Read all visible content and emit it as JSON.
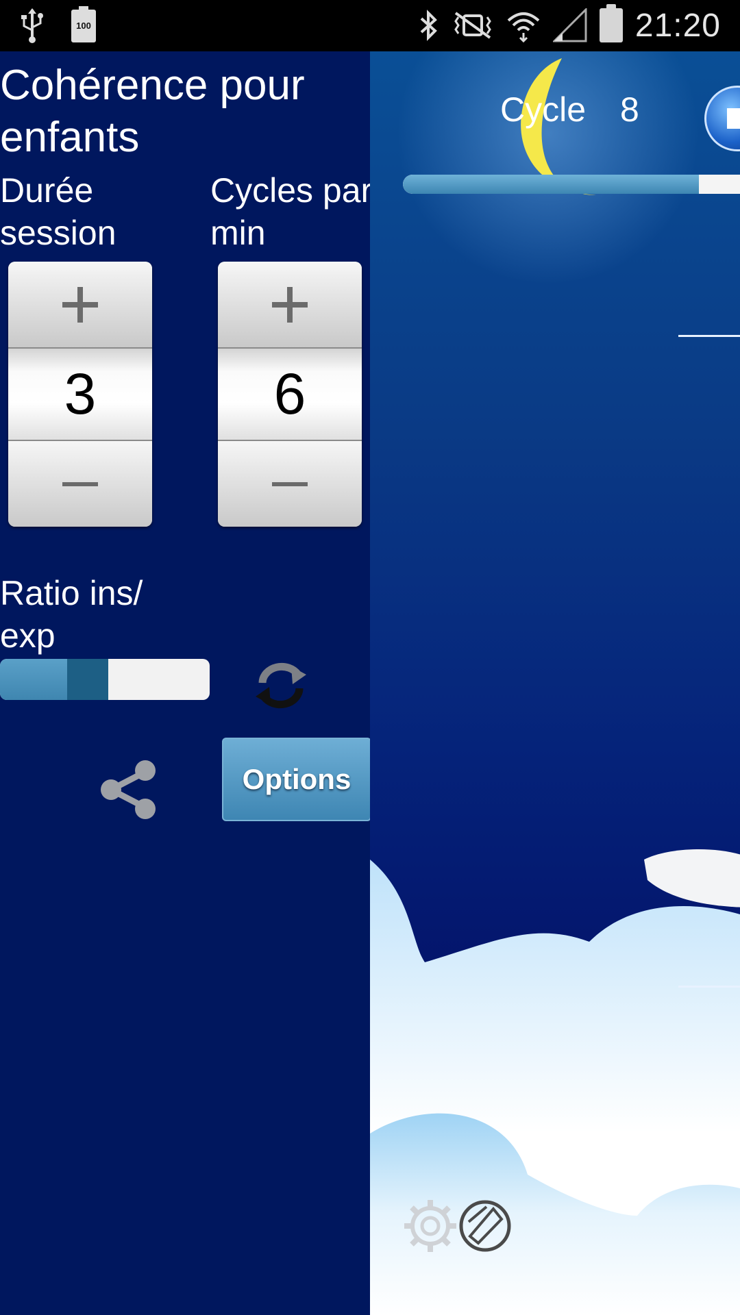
{
  "status_bar": {
    "time": "21:20",
    "battery_level_label": "100",
    "icons": [
      "usb-icon",
      "battery-icon",
      "bluetooth-icon",
      "vibrate-mute-icon",
      "wifi-icon",
      "signal-icon",
      "battery-full-icon"
    ]
  },
  "left_panel": {
    "title": "Cohérence pour enfants",
    "session_duration": {
      "label": "Durée session",
      "value": "3",
      "plus_icon": "plus-icon",
      "minus_icon": "minus-icon"
    },
    "cycles_per_min": {
      "label": "Cycles par min",
      "value": "6",
      "plus_icon": "plus-icon",
      "minus_icon": "minus-icon"
    },
    "ratio": {
      "label": "Ratio ins/ exp",
      "inhale_fraction": 0.4
    },
    "options_label": "Options"
  },
  "scene": {
    "cycle_label": "Cycle",
    "cycle_value": "8",
    "progress_fraction": 0.83
  },
  "colors": {
    "panel_bg": "#00175e",
    "accent": "#3f86b0",
    "slider_thumb": "#1d5f85",
    "moon": "#f5e84a"
  }
}
